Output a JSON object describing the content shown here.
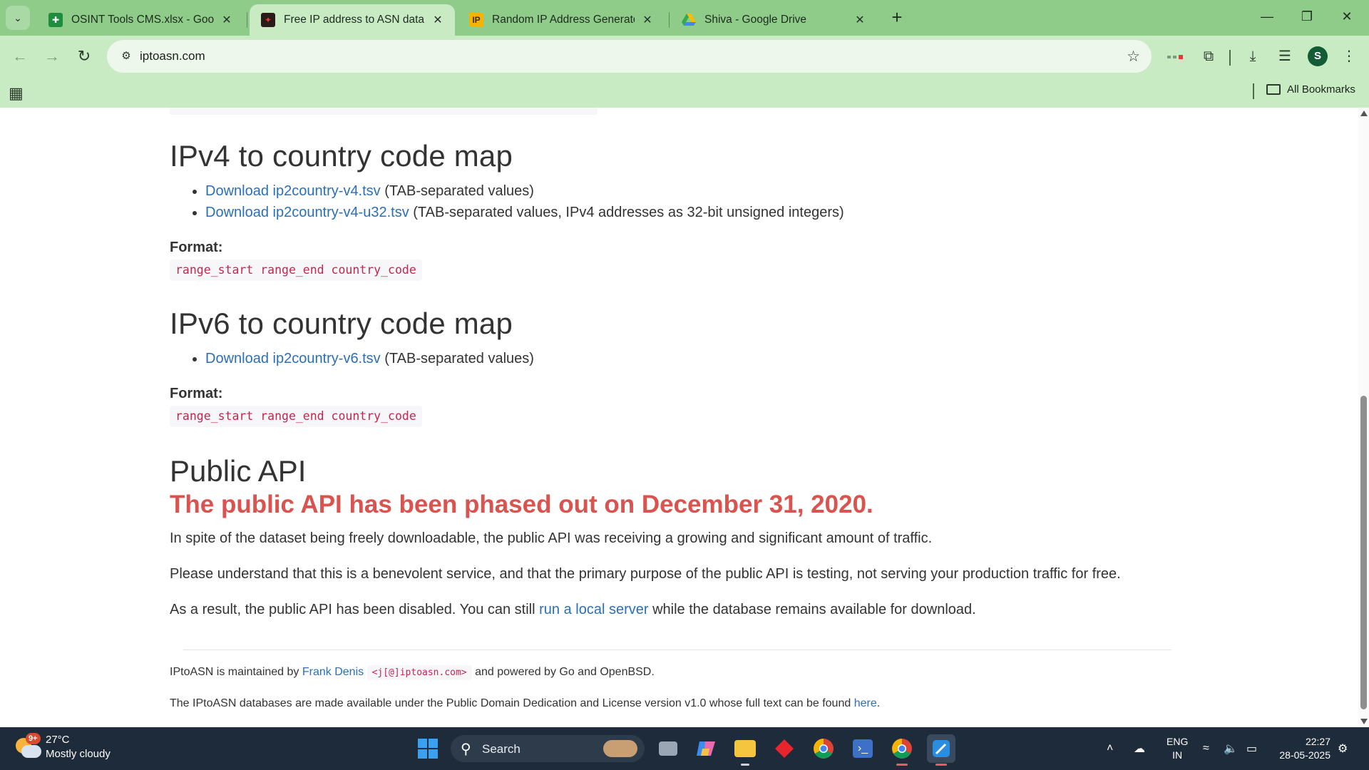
{
  "browser": {
    "tabs": [
      {
        "title": "OSINT Tools CMS.xlsx - Google",
        "favicon": "sheets-icon",
        "active": false
      },
      {
        "title": "Free IP address to ASN databas",
        "favicon": "iptoasn-icon",
        "active": true
      },
      {
        "title": "Random IP Address Generator,",
        "favicon": "ip-icon",
        "active": false
      },
      {
        "title": "Shiva - Google Drive",
        "favicon": "drive-icon",
        "active": false
      }
    ],
    "url": "iptoasn.com",
    "profile_initial": "S",
    "all_bookmarks_label": "All Bookmarks"
  },
  "page": {
    "ipv4": {
      "heading": "IPv4 to country code map",
      "items": [
        {
          "link": "Download ip2country-v4.tsv",
          "note": " (TAB-separated values)"
        },
        {
          "link": "Download ip2country-v4-u32.tsv",
          "note": " (TAB-separated values, IPv4 addresses as 32-bit unsigned integers)"
        }
      ],
      "format_label": "Format:",
      "format_code": "range_start range_end country_code"
    },
    "ipv6": {
      "heading": "IPv6 to country code map",
      "items": [
        {
          "link": "Download ip2country-v6.tsv",
          "note": " (TAB-separated values)"
        }
      ],
      "format_label": "Format:",
      "format_code": "range_start range_end country_code"
    },
    "api": {
      "heading": "Public API",
      "warning": "The public API has been phased out on December 31, 2020.",
      "para1": "In spite of the dataset being freely downloadable, the public API was receiving a growing and significant amount of traffic.",
      "para2": "Please understand that this is a benevolent service, and that the primary purpose of the public API is testing, not serving your production traffic for free.",
      "para3_before": "As a result, the public API has been disabled. You can still ",
      "para3_link": "run a local server",
      "para3_after": " while the database remains available for download."
    },
    "footer": {
      "line1_before": "IPtoASN is maintained by ",
      "line1_link": "Frank Denis",
      "line1_email": "<j[@]iptoasn.com>",
      "line1_after": " and powered by Go and OpenBSD.",
      "line2_before": "The IPtoASN databases are made available under the Public Domain Dedication and License version v1.0 whose full text can be found ",
      "line2_link": "here",
      "line2_after": "."
    }
  },
  "taskbar": {
    "weather_badge": "9+",
    "temperature": "27°C",
    "condition": "Mostly cloudy",
    "search_label": "Search",
    "lang_line1": "ENG",
    "lang_line2": "IN",
    "time": "22:27",
    "date": "28-05-2025"
  },
  "colors": {
    "chrome_green": "#8fcc8a",
    "toolbar_green": "#c8ebc4",
    "link": "#2a6fb8",
    "warning_red": "#d9534f",
    "code_red": "#c7254e",
    "taskbar": "#1e2b3a"
  }
}
